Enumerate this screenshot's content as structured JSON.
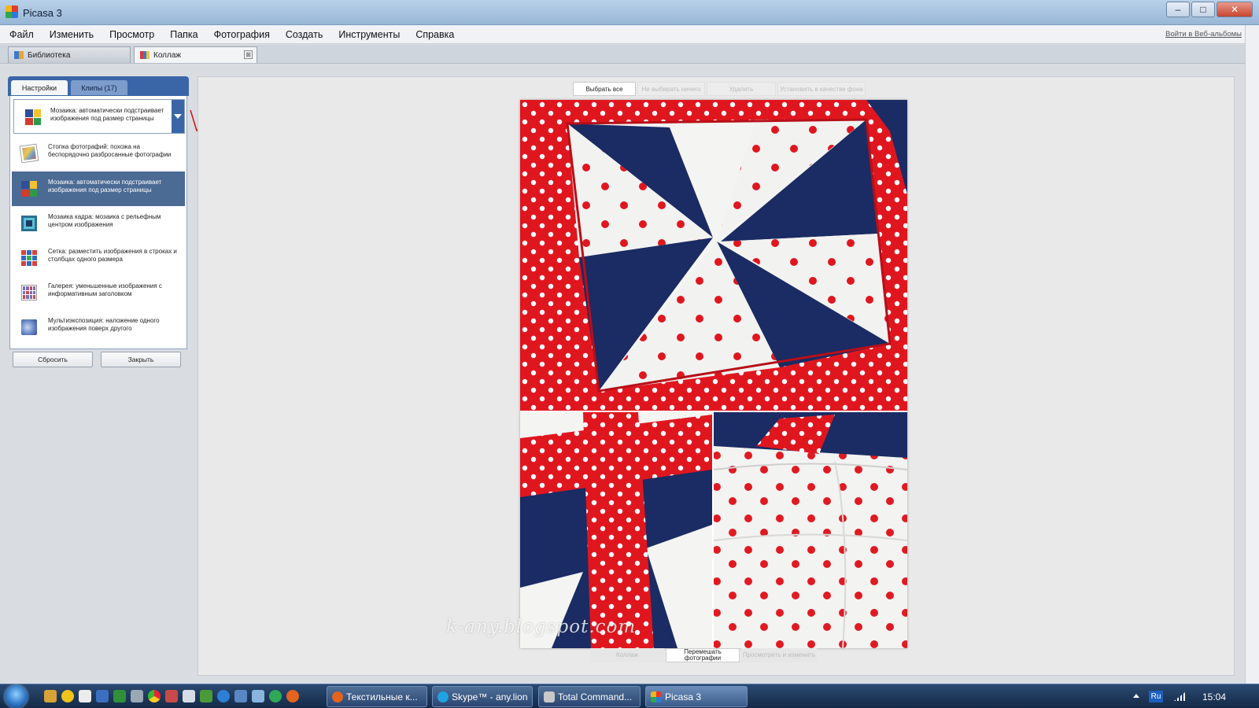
{
  "window": {
    "title": "Picasa 3"
  },
  "menu": {
    "items": [
      "Файл",
      "Изменить",
      "Просмотр",
      "Папка",
      "Фотография",
      "Создать",
      "Инструменты",
      "Справка"
    ],
    "web_albums_link": "Войти в Веб-альбомы"
  },
  "tabs": {
    "library": "Библиотека",
    "collage": "Коллаж",
    "close_glyph": "⊠"
  },
  "panel": {
    "tab_settings": "Настройки",
    "tab_clips": "Клипы (17)",
    "selected_type": "Мозаика: автоматически подстраивает изображения под размер страницы",
    "options": [
      {
        "label": "Стопка фотографий: похожа на беспорядочно разбросанные фотографии",
        "icon": "photo-stack-icon",
        "selected": false
      },
      {
        "label": "Мозаика: автоматически подстраивает изображения под размер страницы",
        "icon": "mosaic-icon",
        "selected": true
      },
      {
        "label": "Мозаика кадра: мозаика с рельефным центром изображения",
        "icon": "frame-mosaic-icon",
        "selected": false
      },
      {
        "label": "Сетка: разместить изображения в строках и столбцах одного размера",
        "icon": "grid-icon",
        "selected": false
      },
      {
        "label": "Галерея: уменьшенные изображения с информативным заголовком",
        "icon": "gallery-icon",
        "selected": false
      },
      {
        "label": "Мультиэкспозиция: наложение одного изображения поверх другого",
        "icon": "multi-exposure-icon",
        "selected": false
      }
    ],
    "reset_button": "Сбросить",
    "close_button": "Закрыть"
  },
  "toolbar": {
    "select_all": "Выбрать все",
    "select_none": "Не выбирать ничего",
    "delete": "Удалить",
    "set_background": "Установить в качестве фона"
  },
  "bottom_toolbar": {
    "collage": "Коллаж",
    "shuffle": "Перемешать фотографии",
    "preview": "Просмотреть и изменить"
  },
  "canvas": {
    "watermark": "k-any.blogspot.com"
  },
  "taskbar": {
    "tasks": [
      {
        "label": "Текстильные к...",
        "color": "#e2641f"
      },
      {
        "label": "Skype™ - any.lion",
        "color": "#1fa3e3"
      },
      {
        "label": "Total Command...",
        "color": "#c8c8c8"
      },
      {
        "label": "Picasa 3",
        "color": "#e03b2f",
        "active": true
      }
    ],
    "language": "Ru",
    "clock": "15:04"
  },
  "colors": {
    "accent": "#3a66a8",
    "selected_row": "#4b6a94",
    "quilt_red": "#e01f26",
    "quilt_navy": "#1a2a5e"
  }
}
